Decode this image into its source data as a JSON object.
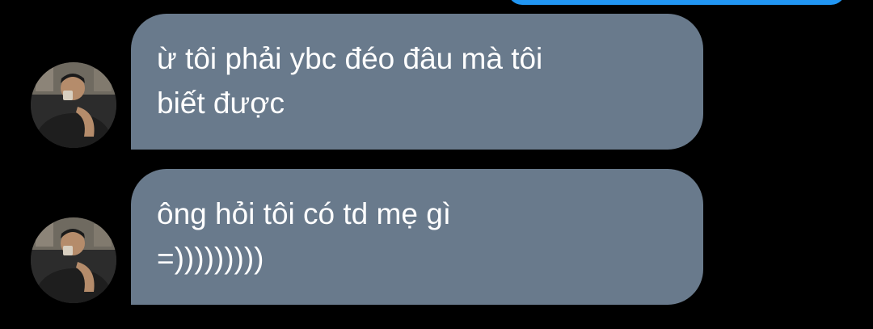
{
  "messages": [
    {
      "text": "ừ tôi phải ybc đéo đâu mà tôi\nbiết được"
    },
    {
      "text": "ông hỏi tôi có td mẹ gì\n=)))))))))"
    }
  ],
  "colors": {
    "background": "#000000",
    "received_bubble": "#697a8c",
    "sent_bubble": "#2196f3",
    "text": "#ffffff"
  },
  "icons": {
    "avatar": "contact-avatar-photo"
  }
}
